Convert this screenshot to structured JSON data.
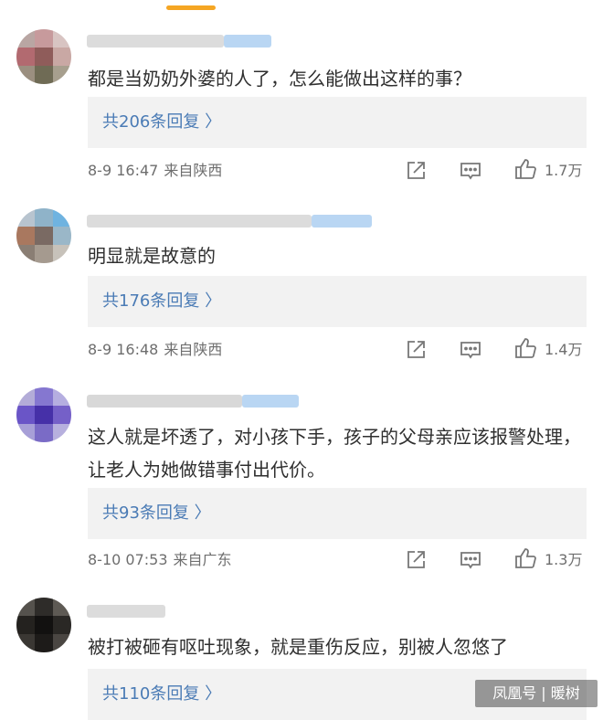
{
  "comments": [
    {
      "text": "都是当奶奶外婆的人了，怎么能做出这样的事？",
      "replies": "共206条回复 〉",
      "date": "8-9 16:47",
      "location": "来自陕西",
      "likes": "1.7万"
    },
    {
      "text": "明显就是故意的",
      "replies": "共176条回复 〉",
      "date": "8-9 16:48",
      "location": "来自陕西",
      "likes": "1.4万"
    },
    {
      "text": "这人就是坏透了，对小孩下手，孩子的父母亲应该报警处理，让老人为她做错事付出代价。",
      "replies": "共93条回复 〉",
      "date": "8-10 07:53",
      "location": "来自广东",
      "likes": "1.3万"
    },
    {
      "text": "被打被砸有呕吐现象，就是重伤反应，别被人忽悠了",
      "replies": "共110条回复 〉"
    }
  ],
  "watermark": "凤凰号 | 暖树",
  "icons": {
    "share": "share-icon",
    "comment": "comment-icon",
    "like": "thumbs-up-icon"
  },
  "colors": {
    "reply_link": "#4a7bb5",
    "reply_bg": "#f2f2f2",
    "tab_accent": "#f5a623"
  }
}
